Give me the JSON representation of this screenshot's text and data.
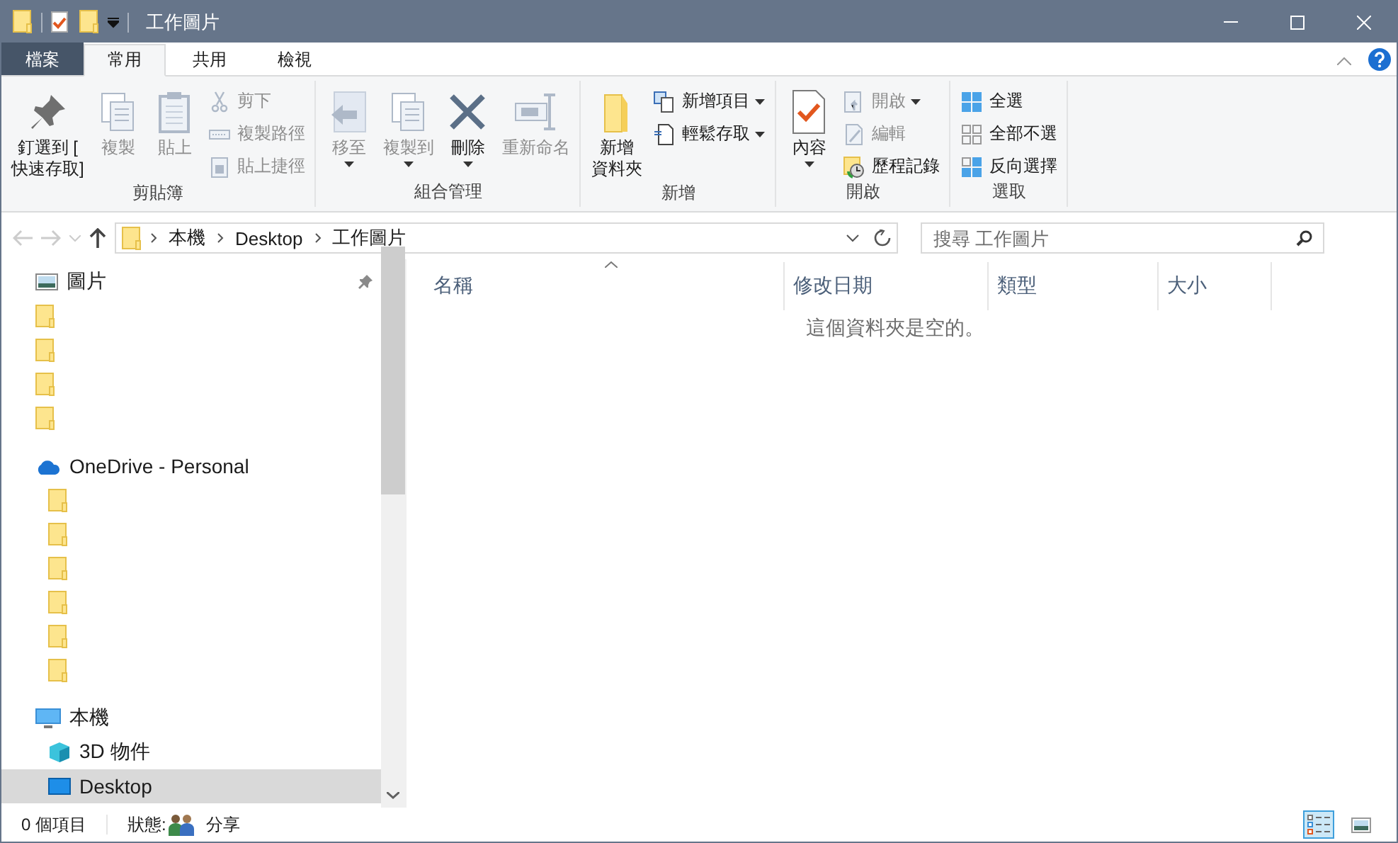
{
  "window": {
    "title": "工作圖片"
  },
  "ribbon_tabs": [
    {
      "label": "檔案",
      "kind": "file",
      "selected": false
    },
    {
      "label": "常用",
      "kind": "tab",
      "selected": true
    },
    {
      "label": "共用",
      "kind": "tab",
      "selected": false
    },
    {
      "label": "檢視",
      "kind": "tab",
      "selected": false
    }
  ],
  "ribbon_groups": [
    {
      "label": "剪貼簿",
      "buttons": [
        {
          "kind": "large",
          "label_lines": [
            "釘選到 [",
            "快速存取]"
          ],
          "disabled": false,
          "menu": false
        },
        {
          "kind": "large",
          "label_lines": [
            "複製"
          ],
          "disabled": true,
          "menu": false
        },
        {
          "kind": "large",
          "label_lines": [
            "貼上"
          ],
          "disabled": true,
          "menu": false
        },
        {
          "kind": "small",
          "label_lines": [
            "剪下"
          ],
          "disabled": true,
          "menu": false
        },
        {
          "kind": "small",
          "label_lines": [
            "複製路徑"
          ],
          "disabled": true,
          "menu": false
        },
        {
          "kind": "small",
          "label_lines": [
            "貼上捷徑"
          ],
          "disabled": true,
          "menu": false
        }
      ]
    },
    {
      "label": "組合管理",
      "buttons": [
        {
          "kind": "large",
          "label_lines": [
            "移至"
          ],
          "disabled": true,
          "menu": true
        },
        {
          "kind": "large",
          "label_lines": [
            "複製到"
          ],
          "disabled": true,
          "menu": true
        },
        {
          "kind": "large",
          "label_lines": [
            "刪除"
          ],
          "disabled": false,
          "menu": true
        },
        {
          "kind": "large",
          "label_lines": [
            "重新命名"
          ],
          "disabled": true,
          "menu": false
        }
      ]
    },
    {
      "label": "新增",
      "buttons": [
        {
          "kind": "large",
          "label_lines": [
            "新增",
            "資料夾"
          ],
          "disabled": false,
          "menu": false
        },
        {
          "kind": "small",
          "label_lines": [
            "新增項目"
          ],
          "disabled": false,
          "menu": true
        },
        {
          "kind": "small",
          "label_lines": [
            "輕鬆存取"
          ],
          "disabled": false,
          "menu": true
        }
      ]
    },
    {
      "label": "開啟",
      "buttons": [
        {
          "kind": "large",
          "label_lines": [
            "內容"
          ],
          "disabled": false,
          "menu": true
        },
        {
          "kind": "small",
          "label_lines": [
            "開啟"
          ],
          "disabled": true,
          "menu": true
        },
        {
          "kind": "small",
          "label_lines": [
            "編輯"
          ],
          "disabled": true,
          "menu": false
        },
        {
          "kind": "small",
          "label_lines": [
            "歷程記錄"
          ],
          "disabled": false,
          "menu": false
        }
      ]
    },
    {
      "label": "選取",
      "buttons": [
        {
          "kind": "small",
          "label_lines": [
            "全選"
          ],
          "disabled": false,
          "menu": false
        },
        {
          "kind": "small",
          "label_lines": [
            "全部不選"
          ],
          "disabled": false,
          "menu": false
        },
        {
          "kind": "small",
          "label_lines": [
            "反向選擇"
          ],
          "disabled": false,
          "menu": false
        }
      ]
    }
  ],
  "address": {
    "path": [
      "本機",
      "Desktop",
      "工作圖片"
    ]
  },
  "search": {
    "placeholder": "搜尋 工作圖片"
  },
  "nav_tree": [
    {
      "kind": "pictures",
      "label": "圖片",
      "pinned": true,
      "selected": false
    },
    {
      "kind": "folder",
      "selected": false
    },
    {
      "kind": "folder",
      "selected": false
    },
    {
      "kind": "folder",
      "selected": false
    },
    {
      "kind": "folder",
      "selected": false
    },
    {
      "kind": "onedrive",
      "label": "OneDrive - Personal",
      "selected": false,
      "children": [
        {
          "kind": "folder",
          "selected": false
        },
        {
          "kind": "folder",
          "selected": false
        },
        {
          "kind": "folder",
          "selected": false
        },
        {
          "kind": "folder",
          "selected": false
        },
        {
          "kind": "folder",
          "selected": false
        },
        {
          "kind": "folder",
          "selected": false
        }
      ]
    },
    {
      "kind": "pc",
      "label": "本機",
      "selected": false,
      "children": [
        {
          "kind": "objects3d",
          "label": "3D 物件",
          "selected": false
        },
        {
          "kind": "desktop",
          "label": "Desktop",
          "selected": true
        }
      ]
    }
  ],
  "columns": [
    {
      "label": "名稱",
      "sorted": true
    },
    {
      "label": "修改日期",
      "sorted": false
    },
    {
      "label": "類型",
      "sorted": false
    },
    {
      "label": "大小",
      "sorted": false
    }
  ],
  "empty_message": "這個資料夾是空的。",
  "status_bar": {
    "item_count": "0 個項目",
    "state_label": "狀態:",
    "share_label": "分享"
  },
  "view_buttons": [
    {
      "kind": "details",
      "selected": true
    },
    {
      "kind": "large_icons",
      "selected": false
    }
  ]
}
